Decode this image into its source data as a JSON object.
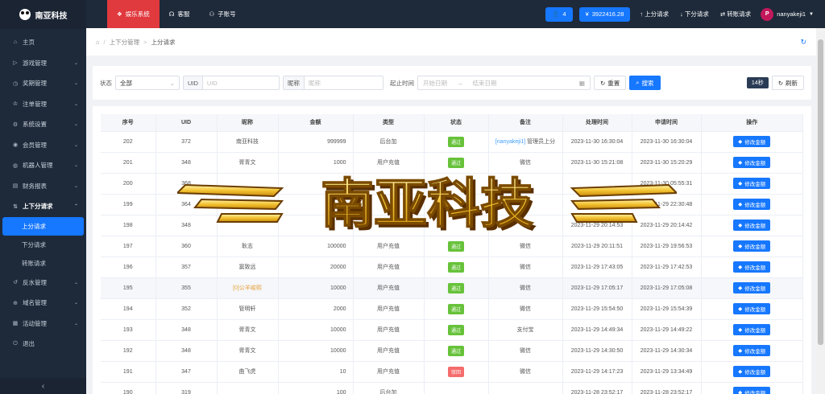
{
  "brand": {
    "name": "南亚科技"
  },
  "sidebar": {
    "items": [
      {
        "label": "主页",
        "icon": "home-icon",
        "arrow": false
      },
      {
        "label": "游戏管理",
        "icon": "play-icon",
        "arrow": true
      },
      {
        "label": "奖期管理",
        "icon": "clock-icon",
        "arrow": true
      },
      {
        "label": "注单管理",
        "icon": "trophy-icon",
        "arrow": true
      },
      {
        "label": "系统设置",
        "icon": "gear-icon",
        "arrow": true
      },
      {
        "label": "会员管理",
        "icon": "user-icon",
        "arrow": true
      },
      {
        "label": "机器人管理",
        "icon": "robot-icon",
        "arrow": true
      },
      {
        "label": "财务报表",
        "icon": "chart-icon",
        "arrow": true
      },
      {
        "label": "上下分请求",
        "icon": "transfer-icon",
        "arrow": true,
        "open": true
      }
    ],
    "subitems": [
      {
        "label": "上分请求",
        "active": true
      },
      {
        "label": "下分请求",
        "active": false
      },
      {
        "label": "转账请求",
        "active": false
      }
    ],
    "items_after": [
      {
        "label": "反水管理",
        "icon": "refund-icon"
      },
      {
        "label": "域名管理",
        "icon": "globe-icon"
      },
      {
        "label": "活动管理",
        "icon": "calendar-icon"
      },
      {
        "label": "退出",
        "icon": "logout-icon"
      }
    ]
  },
  "topbar": {
    "tabs": [
      {
        "label": "娱乐系统",
        "icon": "gift-icon",
        "active": true
      },
      {
        "label": "客服",
        "icon": "headset-icon",
        "active": false
      },
      {
        "label": "子账号",
        "icon": "users-icon",
        "active": false
      }
    ],
    "online_count": "4",
    "balance": "3922416.28",
    "links": [
      {
        "label": "上分请求",
        "icon": "arrow-up-icon"
      },
      {
        "label": "下分请求",
        "icon": "arrow-down-icon"
      },
      {
        "label": "转账请求",
        "icon": "exchange-icon"
      }
    ],
    "user": {
      "initial": "P",
      "name": "nanyakeji1"
    }
  },
  "breadcrumb": [
    "上下分管理",
    "上分请求"
  ],
  "filter": {
    "status_label": "状态",
    "status_value": "全部",
    "uid_label": "UID",
    "uid_placeholder": "UID",
    "nick_label": "昵称",
    "nick_placeholder": "昵称",
    "time_label": "起止时间",
    "start_placeholder": "开始日期",
    "end_placeholder": "结束日期",
    "reset_label": "重置",
    "search_label": "搜索",
    "interval_badge": "14秒",
    "refresh_label": "刷新"
  },
  "table": {
    "headers": [
      "序号",
      "UID",
      "昵称",
      "金额",
      "类型",
      "状态",
      "备注",
      "处理时间",
      "申请时间",
      "操作"
    ],
    "rows": [
      {
        "id": "202",
        "uid": "372",
        "nick": "南亚科技",
        "amount": "999999",
        "type": "后台加",
        "status": "通过",
        "remark": "[nanyakeji1] 管理员上分",
        "proc": "2023-11-30 16:30:04",
        "apply": "2023-11-30 16:30:04",
        "op": "修改金额"
      },
      {
        "id": "201",
        "uid": "348",
        "nick": "胥青文",
        "amount": "1000",
        "type": "用户充值",
        "status": "通过",
        "remark": "微信",
        "proc": "2023-11-30 15:21:08",
        "apply": "2023-11-30 15:20:29",
        "op": "修改金额"
      },
      {
        "id": "200",
        "uid": "368",
        "nick": "",
        "amount": "",
        "type": "",
        "status": "",
        "remark": "",
        "proc": "",
        "apply": "2023-11-30 05:55:31",
        "op": "修改金额"
      },
      {
        "id": "199",
        "uid": "364",
        "nick": "",
        "amount": "",
        "type": "",
        "status": "",
        "remark": "",
        "proc": "",
        "apply": "2023-11-29 22:30:48",
        "op": "修改金额"
      },
      {
        "id": "198",
        "uid": "348",
        "nick": "",
        "amount": "",
        "type": "",
        "status": "",
        "remark": "",
        "proc": "2023-11-29 20:14:53",
        "apply": "2023-11-29 20:14:42",
        "op": "修改金额"
      },
      {
        "id": "197",
        "uid": "360",
        "nick": "耿志",
        "amount": "100000",
        "type": "用户充值",
        "status": "通过",
        "remark": "微信",
        "proc": "2023-11-29 20:11:51",
        "apply": "2023-11-29 19:56:53",
        "op": "修改金额"
      },
      {
        "id": "196",
        "uid": "357",
        "nick": "窦致远",
        "amount": "20000",
        "type": "用户充值",
        "status": "通过",
        "remark": "微信",
        "proc": "2023-11-29 17:43:05",
        "apply": "2023-11-29 17:42:53",
        "op": "修改金额"
      },
      {
        "id": "195",
        "uid": "355",
        "nick": "[0]公羊峻熙",
        "amount": "10000",
        "type": "用户充值",
        "status": "通过",
        "remark": "微信",
        "proc": "2023-11-29 17:05:17",
        "apply": "2023-11-29 17:05:08",
        "op": "修改金额",
        "hl": true,
        "warn": true
      },
      {
        "id": "194",
        "uid": "352",
        "nick": "管明轩",
        "amount": "2000",
        "type": "用户充值",
        "status": "通过",
        "remark": "微信",
        "proc": "2023-11-29 15:54:50",
        "apply": "2023-11-29 15:54:39",
        "op": "修改金额"
      },
      {
        "id": "193",
        "uid": "348",
        "nick": "胥青文",
        "amount": "10000",
        "type": "用户充值",
        "status": "通过",
        "remark": "支付宝",
        "proc": "2023-11-29 14:49:34",
        "apply": "2023-11-29 14:49:22",
        "op": "修改金额"
      },
      {
        "id": "192",
        "uid": "348",
        "nick": "胥青文",
        "amount": "10000",
        "type": "用户充值",
        "status": "通过",
        "remark": "微信",
        "proc": "2023-11-29 14:30:50",
        "apply": "2023-11-29 14:30:34",
        "op": "修改金额"
      },
      {
        "id": "191",
        "uid": "347",
        "nick": "曲飞虎",
        "amount": "10",
        "type": "用户充值",
        "status": "驳回",
        "remark": "微信",
        "proc": "2023-11-29 14:17:23",
        "apply": "2023-11-29 13:34:49",
        "op": "修改金额",
        "reject": true
      },
      {
        "id": "190",
        "uid": "319",
        "nick": "",
        "amount": "100",
        "type": "后台加",
        "status": "",
        "remark": "",
        "proc": "2023-11-28 23:52:17",
        "apply": "2023-11-28 23:52:17",
        "op": "修改金额"
      }
    ]
  },
  "watermark": {
    "text": "南亚科技"
  },
  "colors": {
    "primary": "#1677ff",
    "danger": "#e0393e",
    "success": "#67c23a",
    "sidebar": "#1e2a3a"
  }
}
